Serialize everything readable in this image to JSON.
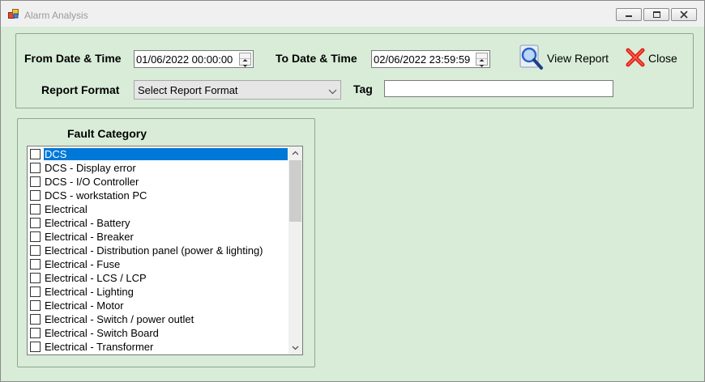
{
  "window": {
    "title": "Alarm Analysis"
  },
  "filters": {
    "from_label": "From Date & Time",
    "from_value": "01/06/2022 00:00:00",
    "to_label": "To Date & Time",
    "to_value": "02/06/2022 23:59:59",
    "format_label": "Report Format",
    "format_value": "Select Report Format",
    "tag_label": "Tag",
    "tag_value": ""
  },
  "toolbar": {
    "view_report_label": "View Report",
    "close_label": "Close"
  },
  "fault_category": {
    "title": "Fault Category",
    "selected_index": 0,
    "items": [
      {
        "label": "DCS",
        "checked": false
      },
      {
        "label": "DCS - Display error",
        "checked": false
      },
      {
        "label": "DCS - I/O Controller",
        "checked": false
      },
      {
        "label": "DCS - workstation PC",
        "checked": false
      },
      {
        "label": "Electrical",
        "checked": false
      },
      {
        "label": "Electrical - Battery",
        "checked": false
      },
      {
        "label": "Electrical - Breaker",
        "checked": false
      },
      {
        "label": "Electrical - Distribution panel (power & lighting)",
        "checked": false
      },
      {
        "label": "Electrical - Fuse",
        "checked": false
      },
      {
        "label": "Electrical - LCS / LCP",
        "checked": false
      },
      {
        "label": "Electrical - Lighting",
        "checked": false
      },
      {
        "label": "Electrical - Motor",
        "checked": false
      },
      {
        "label": "Electrical - Switch / power outlet",
        "checked": false
      },
      {
        "label": "Electrical - Switch Board",
        "checked": false
      },
      {
        "label": "Electrical - Transformer",
        "checked": false
      }
    ]
  },
  "colors": {
    "form_background": "#d8ecd8",
    "selection": "#0078d7",
    "close_icon": "#e0201a",
    "view_icon": "#2a62c6"
  },
  "icons": {
    "app": "app-window-icon",
    "view_report": "magnifier-icon",
    "close": "red-x-icon"
  }
}
